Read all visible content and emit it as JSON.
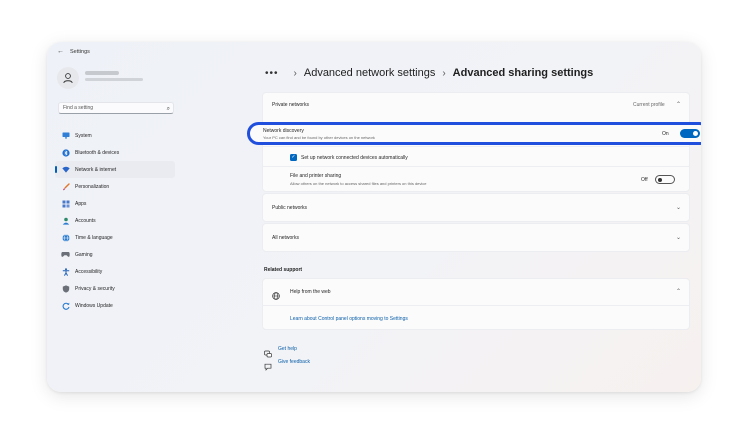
{
  "app": {
    "title": "Settings",
    "back_glyph": "←"
  },
  "search": {
    "placeholder": "Find a setting"
  },
  "nav": [
    {
      "label": "System",
      "icon": "monitor-icon",
      "color": "#2f7fd6"
    },
    {
      "label": "Bluetooth & devices",
      "icon": "bluetooth-icon",
      "color": "#1f6fd0"
    },
    {
      "label": "Network & internet",
      "icon": "wifi-icon",
      "color": "#2a66c9",
      "active": true
    },
    {
      "label": "Personalization",
      "icon": "brush-icon",
      "color": "#e0772a"
    },
    {
      "label": "Apps",
      "icon": "apps-icon",
      "color": "#4a78c8"
    },
    {
      "label": "Accounts",
      "icon": "person-icon",
      "color": "#2c8a6a"
    },
    {
      "label": "Time & language",
      "icon": "globe-icon",
      "color": "#2a7bd0"
    },
    {
      "label": "Gaming",
      "icon": "gamepad-icon",
      "color": "#6a6f78"
    },
    {
      "label": "Accessibility",
      "icon": "accessibility-icon",
      "color": "#1d5fb8"
    },
    {
      "label": "Privacy & security",
      "icon": "shield-icon",
      "color": "#6a6f78"
    },
    {
      "label": "Windows Update",
      "icon": "update-icon",
      "color": "#2a7bd0"
    }
  ],
  "breadcrumb": {
    "parent": "Advanced network settings",
    "current": "Advanced sharing settings"
  },
  "private": {
    "title": "Private networks",
    "badge": "Current profile",
    "discovery": {
      "label": "Network discovery",
      "sub": "Your PC can find and be found by other devices on the network",
      "state": "On"
    },
    "auto_setup": "Set up network connected devices automatically",
    "file_sharing": {
      "label": "File and printer sharing",
      "sub": "Allow others on the network to access shared files and printers on this device",
      "state": "Off"
    }
  },
  "public": {
    "title": "Public networks"
  },
  "all": {
    "title": "All networks"
  },
  "support": {
    "heading": "Related support",
    "help_title": "Help from the web",
    "link": "Learn about Control panel options moving to Settings"
  },
  "footer": {
    "get_help": "Get help",
    "feedback": "Give feedback"
  },
  "colors": {
    "accent": "#0067c0",
    "highlight": "#1f4fdc"
  }
}
